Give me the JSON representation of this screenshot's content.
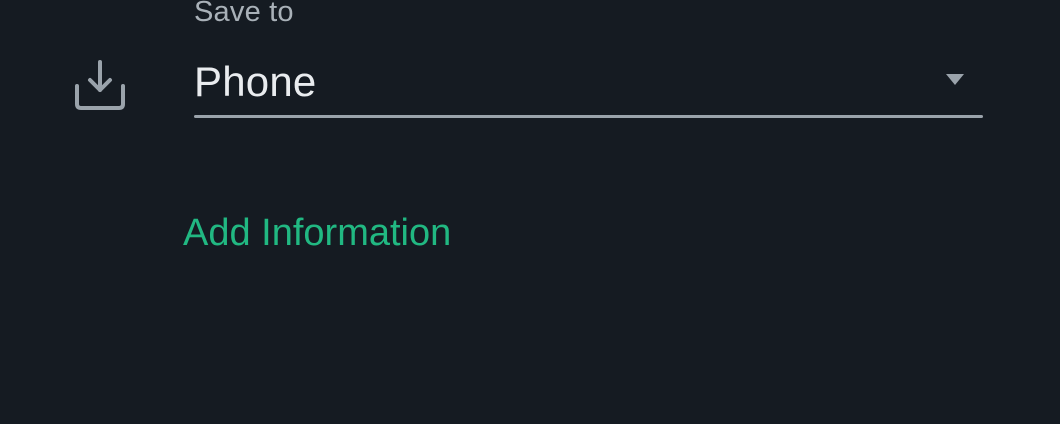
{
  "form": {
    "save_to_label": "Save to",
    "save_to_value": "Phone",
    "add_information_label": "Add Information"
  },
  "icons": {
    "download": "download-icon",
    "dropdown": "chevron-down-icon"
  },
  "colors": {
    "background": "#151b22",
    "label": "#a9b1b8",
    "value": "#e9ecef",
    "underline": "#9aa3ab",
    "accent": "#21b882"
  }
}
